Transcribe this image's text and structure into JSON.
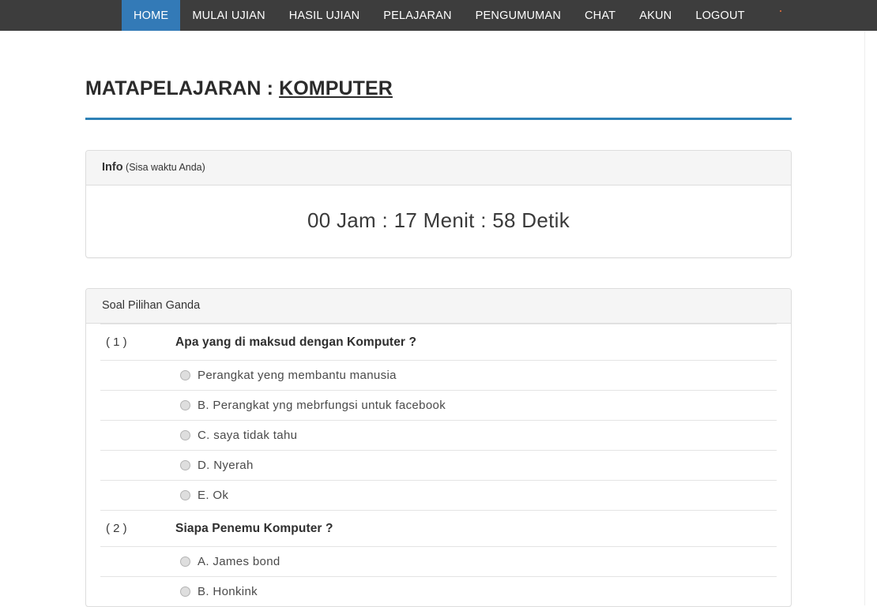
{
  "navbar": {
    "items": [
      {
        "label": "HOME",
        "active": true
      },
      {
        "label": "MULAI UJIAN",
        "active": false
      },
      {
        "label": "HASIL UJIAN",
        "active": false
      },
      {
        "label": "PELAJARAN",
        "active": false
      },
      {
        "label": "PENGUMUMAN",
        "active": false
      },
      {
        "label": "CHAT",
        "active": false
      },
      {
        "label": "AKUN",
        "active": false
      },
      {
        "label": "LOGOUT",
        "active": false
      }
    ],
    "background_color": "#3d3d3d",
    "active_color": "#337ab7"
  },
  "page": {
    "title_prefix": "MATAPELAJARAN : ",
    "subject": "KOMPUTER",
    "rule_color": "#2e81b6"
  },
  "info_panel": {
    "heading_strong": "Info",
    "heading_muted": " (Sisa waktu Anda)",
    "timer": "00 Jam : 17 Menit : 58 Detik"
  },
  "questions_panel": {
    "heading": "Soal Pilihan Ganda",
    "questions": [
      {
        "number": "( 1 )",
        "text": "Apa yang di maksud dengan Komputer ?",
        "options": [
          {
            "label": "Perangkat yeng membantu manusia",
            "selected": false
          },
          {
            "label": "B. Perangkat yng mebrfungsi untuk facebook",
            "selected": false
          },
          {
            "label": "C. saya tidak tahu",
            "selected": false
          },
          {
            "label": "D. Nyerah",
            "selected": false
          },
          {
            "label": "E. Ok",
            "selected": false
          }
        ]
      },
      {
        "number": "( 2 )",
        "text": "Siapa Penemu Komputer ?",
        "options": [
          {
            "label": "A. James bond",
            "selected": false
          },
          {
            "label": "B. Honkink",
            "selected": false
          }
        ]
      }
    ]
  }
}
